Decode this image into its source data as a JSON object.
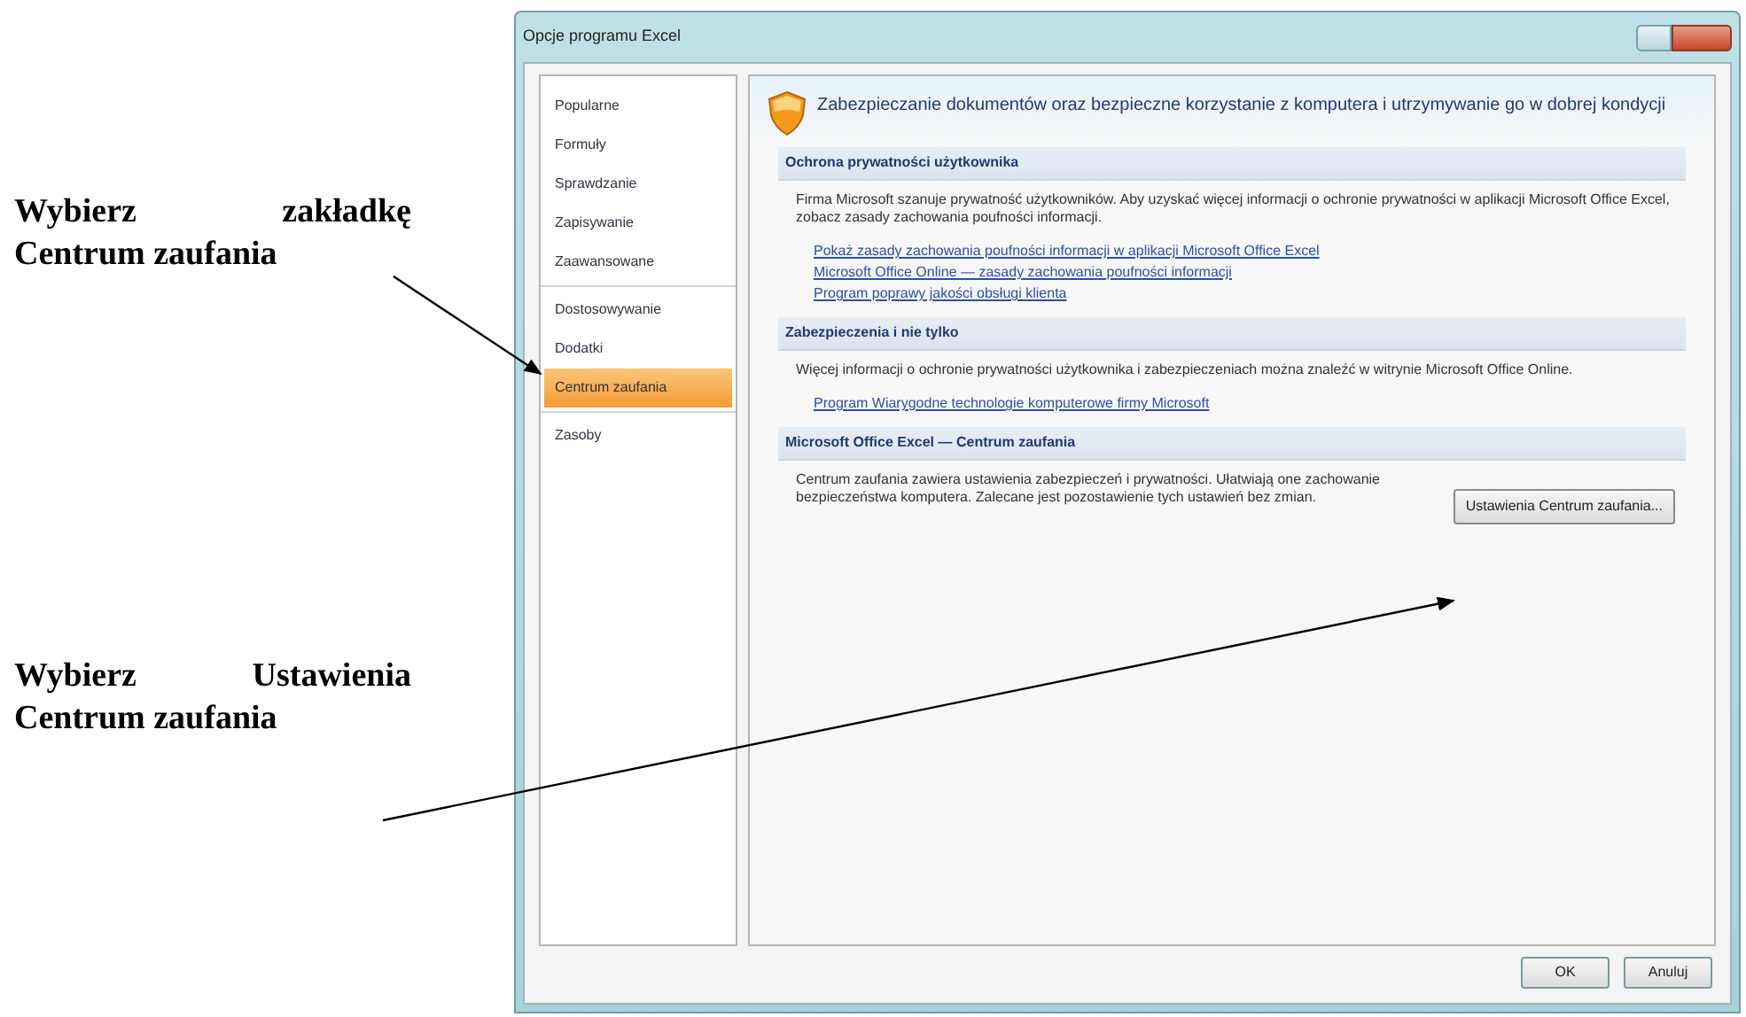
{
  "annotations": [
    {
      "text": "Wybierz zakładkę Centrum zaufania"
    },
    {
      "text": "Wybierz Ustawienia Centrum zaufania"
    }
  ],
  "window": {
    "title": "Opcje programu Excel"
  },
  "sidebar": {
    "groups": [
      {
        "items": [
          {
            "label": "Popularne",
            "selected": false
          },
          {
            "label": "Formuły",
            "selected": false
          },
          {
            "label": "Sprawdzanie",
            "selected": false
          },
          {
            "label": "Zapisywanie",
            "selected": false
          },
          {
            "label": "Zaawansowane",
            "selected": false
          }
        ]
      },
      {
        "items": [
          {
            "label": "Dostosowywanie",
            "selected": false
          },
          {
            "label": "Dodatki",
            "selected": false
          },
          {
            "label": "Centrum zaufania",
            "selected": true
          }
        ]
      },
      {
        "items": [
          {
            "label": "Zasoby",
            "selected": false
          }
        ]
      }
    ]
  },
  "header": {
    "text": "Zabezpieczanie dokumentów oraz bezpieczne korzystanie z komputera i utrzymywanie go w dobrej kondycji"
  },
  "sections": [
    {
      "heading": "Ochrona prywatności użytkownika",
      "text": "Firma Microsoft szanuje prywatność użytkowników. Aby uzyskać więcej informacji o ochronie prywatności w aplikacji Microsoft Office Excel, zobacz zasady zachowania poufności informacji.",
      "links": [
        "Pokaż zasady zachowania poufności informacji w aplikacji Microsoft Office Excel",
        "Microsoft Office Online — zasady zachowania poufności informacji",
        "Program poprawy jakości obsługi klienta"
      ]
    },
    {
      "heading": "Zabezpieczenia i nie tylko",
      "text": "Więcej informacji o ochronie prywatności użytkownika i zabezpieczeniach można znaleźć w witrynie Microsoft Office Online.",
      "links": [
        "Program Wiarygodne technologie komputerowe firmy Microsoft"
      ]
    },
    {
      "heading": "Microsoft Office Excel — Centrum zaufania",
      "text": "Centrum zaufania zawiera ustawienia zabezpieczeń i prywatności. Ułatwiają one zachowanie bezpieczeństwa komputera. Zalecane jest pozostawienie tych ustawień bez zmian.",
      "button": "Ustawienia Centrum zaufania..."
    }
  ],
  "buttons": [
    "OK",
    "Anuluj"
  ]
}
